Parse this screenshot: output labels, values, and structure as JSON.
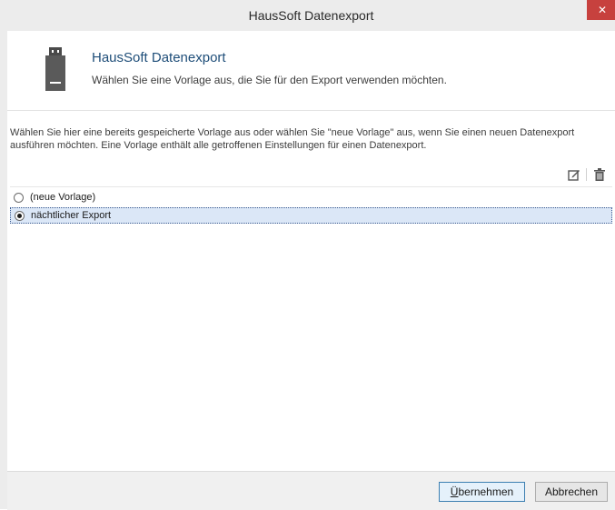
{
  "window": {
    "title": "HausSoft Datenexport",
    "close_glyph": "✕"
  },
  "header": {
    "icon": "usb-drive-icon",
    "title": "HausSoft Datenexport",
    "subtitle": "Wählen Sie eine Vorlage aus, die Sie für den Export verwenden möchten."
  },
  "description": "Wählen Sie hier eine bereits gespeicherte Vorlage aus oder wählen Sie \"neue Vorlage\" aus, wenn Sie einen neuen Datenexport ausführen möchten. Eine Vorlage enthält alle getroffenen Einstellungen für einen Datenexport.",
  "toolbar": {
    "edit_icon": "edit-icon",
    "delete_icon": "trash-icon"
  },
  "templates": [
    {
      "label": "(neue Vorlage)",
      "selected": false
    },
    {
      "label": "nächtlicher Export",
      "selected": true
    }
  ],
  "buttons": {
    "apply_mnemonic": "Ü",
    "apply_rest": "bernehmen",
    "cancel": "Abbrechen"
  },
  "colors": {
    "accent_title": "#1f4e79",
    "close_button": "#c7413e",
    "selection": "#dbe7f7"
  }
}
